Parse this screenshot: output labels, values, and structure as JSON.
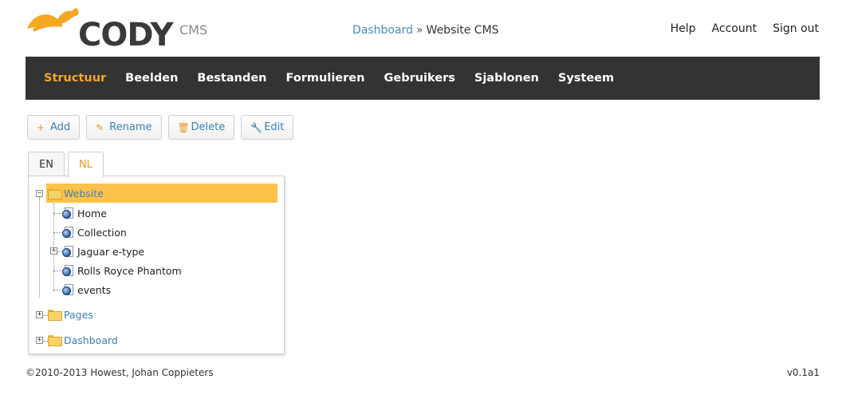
{
  "header": {
    "logo_text": "CODY",
    "logo_suffix": "CMS",
    "breadcrumb": {
      "link": "Dashboard",
      "separator": "»",
      "current": "Website CMS"
    },
    "links": [
      "Help",
      "Account",
      "Sign out"
    ]
  },
  "nav": {
    "items": [
      "Structuur",
      "Beelden",
      "Bestanden",
      "Formulieren",
      "Gebruikers",
      "Sjablonen",
      "Systeem"
    ],
    "active": "Structuur"
  },
  "toolbar": {
    "add": "Add",
    "rename": "Rename",
    "delete": "Delete",
    "edit": "Edit"
  },
  "tabs": [
    "EN",
    "NL"
  ],
  "active_tab": "NL",
  "tree": {
    "root": "Website",
    "children": [
      "Home",
      "Collection",
      "Jaguar e-type",
      "Rolls Royce Phantom",
      "events"
    ],
    "other_roots": [
      "Pages",
      "Dashboard"
    ]
  },
  "footer": {
    "copyright": "©2010-2013 Howest, Johan Coppieters",
    "version": "v0.1a1"
  },
  "colors": {
    "accent": "#f5a623",
    "navbar": "#333333",
    "link": "#3c7fb1",
    "selection": "#fdc24b"
  }
}
